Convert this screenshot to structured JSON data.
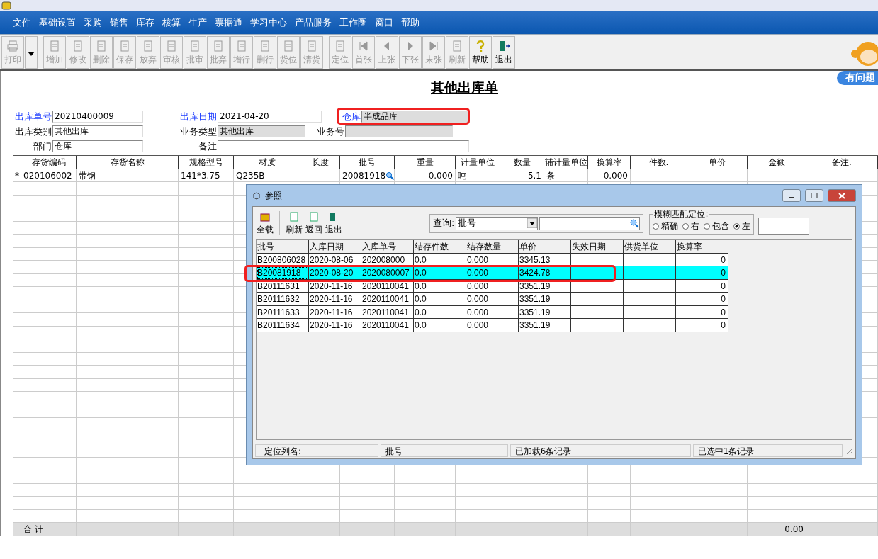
{
  "menu": [
    "文件",
    "基础设置",
    "采购",
    "销售",
    "库存",
    "核算",
    "生产",
    "票据通",
    "学习中心",
    "产品服务",
    "工作圈",
    "窗口",
    "帮助"
  ],
  "toolbar": [
    {
      "label": "打印",
      "disabled": true
    },
    {
      "label": "增加",
      "disabled": true
    },
    {
      "label": "修改",
      "disabled": true
    },
    {
      "label": "删除",
      "disabled": true
    },
    {
      "label": "保存",
      "disabled": true
    },
    {
      "label": "放弃",
      "disabled": true
    },
    {
      "label": "审核",
      "disabled": true
    },
    {
      "label": "批审",
      "disabled": true
    },
    {
      "label": "批弃",
      "disabled": true
    },
    {
      "label": "增行",
      "disabled": true
    },
    {
      "label": "删行",
      "disabled": true
    },
    {
      "label": "货位",
      "disabled": true
    },
    {
      "label": "清货",
      "disabled": true
    },
    {
      "label": "定位",
      "disabled": true
    },
    {
      "label": "首张",
      "disabled": true
    },
    {
      "label": "上张",
      "disabled": true
    },
    {
      "label": "下张",
      "disabled": true
    },
    {
      "label": "末张",
      "disabled": true
    },
    {
      "label": "刷新",
      "disabled": true
    },
    {
      "label": "帮助",
      "disabled": false
    },
    {
      "label": "退出",
      "disabled": false
    }
  ],
  "help_badge": "有问题",
  "form": {
    "title": "其他出库单",
    "fields": [
      {
        "label": "出库单号",
        "value": "20210400009",
        "required": true,
        "readonly": false
      },
      {
        "label": "出库日期",
        "value": "2021-04-20",
        "required": true,
        "readonly": false
      },
      {
        "label": "仓库",
        "value": "半成品库",
        "required": true,
        "readonly": true
      },
      {
        "label": "出库类别",
        "value": "其他出库",
        "required": false,
        "readonly": false
      },
      {
        "label": "业务类型",
        "value": "其他出库",
        "required": false,
        "readonly": true
      },
      {
        "label": "业务号",
        "required": false,
        "readonly": true
      },
      {
        "label": "部门",
        "value": "仓库",
        "required": false,
        "readonly": false
      },
      {
        "label": "备注",
        "required": false,
        "readonly": false
      }
    ]
  },
  "grid": {
    "columns": [
      "",
      "存货编码",
      "存货名称",
      "规格型号",
      "材质",
      "长度",
      "批号",
      "重量",
      "计量单位",
      "数量",
      "辅计量单位",
      "换算率",
      "件数.",
      "单价",
      "金额",
      "备注."
    ],
    "rows": [
      {
        "cells": [
          "*",
          "020106002",
          "带钢",
          "141*3.75",
          "Q235B",
          "",
          "20081918",
          "0.000",
          "吨",
          "5.1",
          "条",
          "0.000",
          "",
          "",
          "",
          ""
        ]
      }
    ],
    "total_label": "合 计",
    "total_amount": "0.00"
  },
  "dialog": {
    "title": "参照",
    "tools": [
      "全载",
      "刷新",
      "返回",
      "退出"
    ],
    "query_label": "查询:",
    "query_field": "批号",
    "match_label": "模糊匹配定位:",
    "match_options": [
      {
        "label": "精确",
        "selected": false
      },
      {
        "label": "右",
        "selected": false
      },
      {
        "label": "包含",
        "selected": false
      },
      {
        "label": "左",
        "selected": true
      }
    ],
    "columns": [
      "批号",
      "入库日期",
      "入库单号",
      "结存件数",
      "结存数量",
      "单价",
      "失效日期",
      "供货单位",
      "换算率"
    ],
    "rows": [
      {
        "cells": [
          "B200806028",
          "2020-08-06",
          "202008000",
          "0.0",
          "0.000",
          "3345.13",
          "",
          "",
          "0"
        ],
        "selected": false
      },
      {
        "cells": [
          "B20081918",
          "2020-08-20",
          "2020080007",
          "0.0",
          "0.000",
          "3424.78",
          "",
          "",
          "0"
        ],
        "selected": true
      },
      {
        "cells": [
          "B20111631",
          "2020-11-16",
          "2020110041",
          "0.0",
          "0.000",
          "3351.19",
          "",
          "",
          "0"
        ],
        "selected": false
      },
      {
        "cells": [
          "B20111632",
          "2020-11-16",
          "2020110041",
          "0.0",
          "0.000",
          "3351.19",
          "",
          "",
          "0"
        ],
        "selected": false
      },
      {
        "cells": [
          "B20111633",
          "2020-11-16",
          "2020110041",
          "0.0",
          "0.000",
          "3351.19",
          "",
          "",
          "0"
        ],
        "selected": false
      },
      {
        "cells": [
          "B20111634",
          "2020-11-16",
          "2020110041",
          "0.0",
          "0.000",
          "3351.19",
          "",
          "",
          "0"
        ],
        "selected": false
      }
    ],
    "status": [
      "定位列名:",
      "批号",
      "已加载6条记录",
      "已选中1条记录"
    ]
  }
}
